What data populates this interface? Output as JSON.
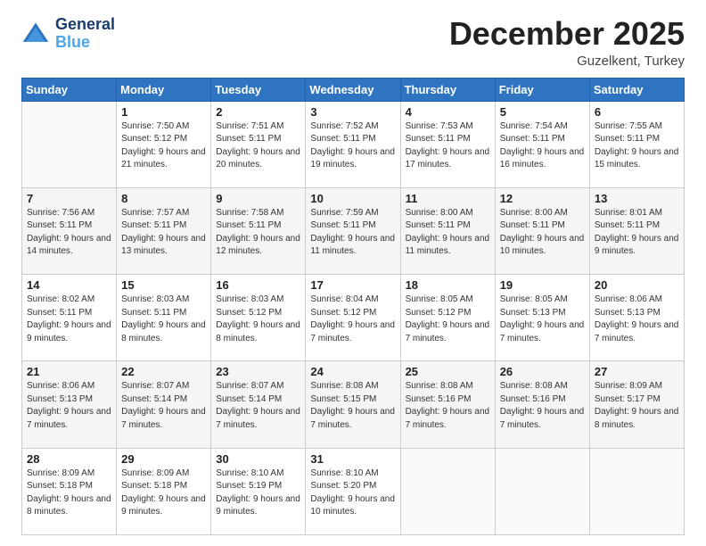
{
  "logo": {
    "line1": "General",
    "line2": "Blue"
  },
  "title": "December 2025",
  "subtitle": "Guzelkent, Turkey",
  "header_days": [
    "Sunday",
    "Monday",
    "Tuesday",
    "Wednesday",
    "Thursday",
    "Friday",
    "Saturday"
  ],
  "weeks": [
    [
      {
        "num": "",
        "info": ""
      },
      {
        "num": "1",
        "info": "Sunrise: 7:50 AM\nSunset: 5:12 PM\nDaylight: 9 hours\nand 21 minutes."
      },
      {
        "num": "2",
        "info": "Sunrise: 7:51 AM\nSunset: 5:11 PM\nDaylight: 9 hours\nand 20 minutes."
      },
      {
        "num": "3",
        "info": "Sunrise: 7:52 AM\nSunset: 5:11 PM\nDaylight: 9 hours\nand 19 minutes."
      },
      {
        "num": "4",
        "info": "Sunrise: 7:53 AM\nSunset: 5:11 PM\nDaylight: 9 hours\nand 17 minutes."
      },
      {
        "num": "5",
        "info": "Sunrise: 7:54 AM\nSunset: 5:11 PM\nDaylight: 9 hours\nand 16 minutes."
      },
      {
        "num": "6",
        "info": "Sunrise: 7:55 AM\nSunset: 5:11 PM\nDaylight: 9 hours\nand 15 minutes."
      }
    ],
    [
      {
        "num": "7",
        "info": "Sunrise: 7:56 AM\nSunset: 5:11 PM\nDaylight: 9 hours\nand 14 minutes."
      },
      {
        "num": "8",
        "info": "Sunrise: 7:57 AM\nSunset: 5:11 PM\nDaylight: 9 hours\nand 13 minutes."
      },
      {
        "num": "9",
        "info": "Sunrise: 7:58 AM\nSunset: 5:11 PM\nDaylight: 9 hours\nand 12 minutes."
      },
      {
        "num": "10",
        "info": "Sunrise: 7:59 AM\nSunset: 5:11 PM\nDaylight: 9 hours\nand 11 minutes."
      },
      {
        "num": "11",
        "info": "Sunrise: 8:00 AM\nSunset: 5:11 PM\nDaylight: 9 hours\nand 11 minutes."
      },
      {
        "num": "12",
        "info": "Sunrise: 8:00 AM\nSunset: 5:11 PM\nDaylight: 9 hours\nand 10 minutes."
      },
      {
        "num": "13",
        "info": "Sunrise: 8:01 AM\nSunset: 5:11 PM\nDaylight: 9 hours\nand 9 minutes."
      }
    ],
    [
      {
        "num": "14",
        "info": "Sunrise: 8:02 AM\nSunset: 5:11 PM\nDaylight: 9 hours\nand 9 minutes."
      },
      {
        "num": "15",
        "info": "Sunrise: 8:03 AM\nSunset: 5:11 PM\nDaylight: 9 hours\nand 8 minutes."
      },
      {
        "num": "16",
        "info": "Sunrise: 8:03 AM\nSunset: 5:12 PM\nDaylight: 9 hours\nand 8 minutes."
      },
      {
        "num": "17",
        "info": "Sunrise: 8:04 AM\nSunset: 5:12 PM\nDaylight: 9 hours\nand 7 minutes."
      },
      {
        "num": "18",
        "info": "Sunrise: 8:05 AM\nSunset: 5:12 PM\nDaylight: 9 hours\nand 7 minutes."
      },
      {
        "num": "19",
        "info": "Sunrise: 8:05 AM\nSunset: 5:13 PM\nDaylight: 9 hours\nand 7 minutes."
      },
      {
        "num": "20",
        "info": "Sunrise: 8:06 AM\nSunset: 5:13 PM\nDaylight: 9 hours\nand 7 minutes."
      }
    ],
    [
      {
        "num": "21",
        "info": "Sunrise: 8:06 AM\nSunset: 5:13 PM\nDaylight: 9 hours\nand 7 minutes."
      },
      {
        "num": "22",
        "info": "Sunrise: 8:07 AM\nSunset: 5:14 PM\nDaylight: 9 hours\nand 7 minutes."
      },
      {
        "num": "23",
        "info": "Sunrise: 8:07 AM\nSunset: 5:14 PM\nDaylight: 9 hours\nand 7 minutes."
      },
      {
        "num": "24",
        "info": "Sunrise: 8:08 AM\nSunset: 5:15 PM\nDaylight: 9 hours\nand 7 minutes."
      },
      {
        "num": "25",
        "info": "Sunrise: 8:08 AM\nSunset: 5:16 PM\nDaylight: 9 hours\nand 7 minutes."
      },
      {
        "num": "26",
        "info": "Sunrise: 8:08 AM\nSunset: 5:16 PM\nDaylight: 9 hours\nand 7 minutes."
      },
      {
        "num": "27",
        "info": "Sunrise: 8:09 AM\nSunset: 5:17 PM\nDaylight: 9 hours\nand 8 minutes."
      }
    ],
    [
      {
        "num": "28",
        "info": "Sunrise: 8:09 AM\nSunset: 5:18 PM\nDaylight: 9 hours\nand 8 minutes."
      },
      {
        "num": "29",
        "info": "Sunrise: 8:09 AM\nSunset: 5:18 PM\nDaylight: 9 hours\nand 9 minutes."
      },
      {
        "num": "30",
        "info": "Sunrise: 8:10 AM\nSunset: 5:19 PM\nDaylight: 9 hours\nand 9 minutes."
      },
      {
        "num": "31",
        "info": "Sunrise: 8:10 AM\nSunset: 5:20 PM\nDaylight: 9 hours\nand 10 minutes."
      },
      {
        "num": "",
        "info": ""
      },
      {
        "num": "",
        "info": ""
      },
      {
        "num": "",
        "info": ""
      }
    ]
  ]
}
